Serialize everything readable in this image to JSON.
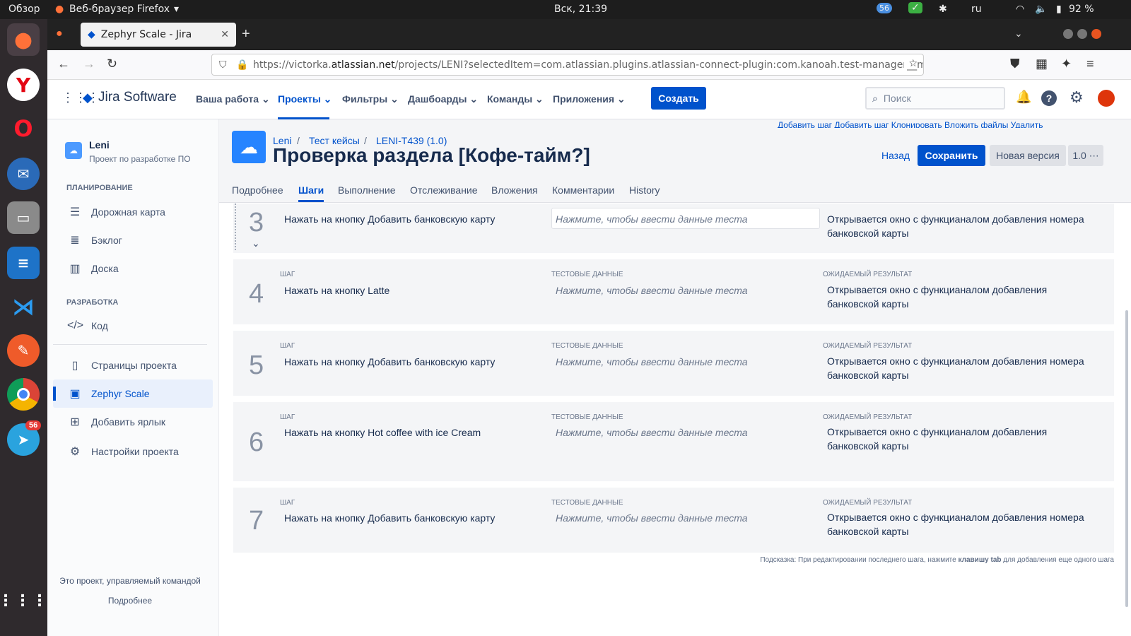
{
  "os": {
    "overview": "Обзор",
    "app": "Веб-браузер Firefox",
    "clock": "Вск, 21:39",
    "notif_count": "56",
    "lang": "ru",
    "battery": "92 %"
  },
  "browser": {
    "tab_title": "Zephyr Scale - Jira",
    "url_prefix": "https://victorka.",
    "url_domain": "atlassian.net",
    "url_rest": "/projects/LENI?selectedItem=com.atlassian.plugins.atlassian-connect-plugin:com.kanoah.test-manager__m"
  },
  "dock": {
    "telegram_badge": "56"
  },
  "jira": {
    "logo": "Jira Software",
    "menu": [
      "Ваша работа",
      "Проекты",
      "Фильтры",
      "Дашбoарды",
      "Команды",
      "Приложения"
    ],
    "create": "Создать",
    "search_placeholder": "Поиск"
  },
  "sidebar": {
    "project_name": "Leni",
    "project_type": "Проект по разработке ПО",
    "planning": "ПЛАНИРОВАНИЕ",
    "items_plan": [
      "Дорожная карта",
      "Бэклог",
      "Доска"
    ],
    "dev": "РАЗРАБОТКА",
    "code": "Код",
    "items_other": [
      "Страницы проекта",
      "Zephyr Scale",
      "Добавить ярлык",
      "Настройки проекта"
    ],
    "footer": "Это проект, управляемый командой",
    "more": "Подробнее"
  },
  "header": {
    "crumbs": [
      "Leni",
      "Тест кейсы",
      "LENI-T439 (1.0)"
    ],
    "title": "Проверка раздела [Кофе-тайм?]",
    "back": "Назад",
    "save": "Сохранить",
    "new_version": "Новая версия",
    "version": "1.0",
    "tabs": [
      "Подробнее",
      "Шаги",
      "Выполнение",
      "Отслеживание",
      "Вложения",
      "Комментарии",
      "History"
    ],
    "cut_actions": "Добавить шаг  Добавить шаг  Клонировать  Вложить файлы  Удалить"
  },
  "labels": {
    "step": "ШАГ",
    "data": "ТЕСТОВЫЕ ДАННЫЕ",
    "result": "ОЖИДАЕМЫЙ РЕЗУЛЬТАТ"
  },
  "steps": [
    {
      "num": "3",
      "text": "Нажать на кнопку Добавить банковскую карту",
      "data": "Нажмите, чтобы ввести данные теста",
      "result": "Открывается окно с функцианалом добавления номера банковской карты"
    },
    {
      "num": "4",
      "text": "Нажать на кнопку Latte",
      "data": "Нажмите, чтобы ввести данные теста",
      "result": "Открывается окно с функцианалом добавления банковской карты"
    },
    {
      "num": "5",
      "text": "Нажать на кнопку Добавить банковскую карту",
      "data": "Нажмите, чтобы ввести данные теста",
      "result": "Открывается окно с функцианалом добавления номера банковской карты"
    },
    {
      "num": "6",
      "text": "Нажать на кнопку Hot coffee with ice Cream",
      "data": "Нажмите, чтобы ввести данные теста",
      "result": "Открывается окно с функцианалом добавления банковской карты"
    },
    {
      "num": "7",
      "text": "Нажать на кнопку Добавить банковскую карту",
      "data": "Нажмите, чтобы ввести данные теста",
      "result": "Открывается окно с функцианалом добавления номера банковской карты"
    }
  ],
  "hint": {
    "pre": "Подсказка: При редактировании последнего шага, нажмите ",
    "key": "клавишу tab",
    "post": " для добавления еще одного шага"
  }
}
